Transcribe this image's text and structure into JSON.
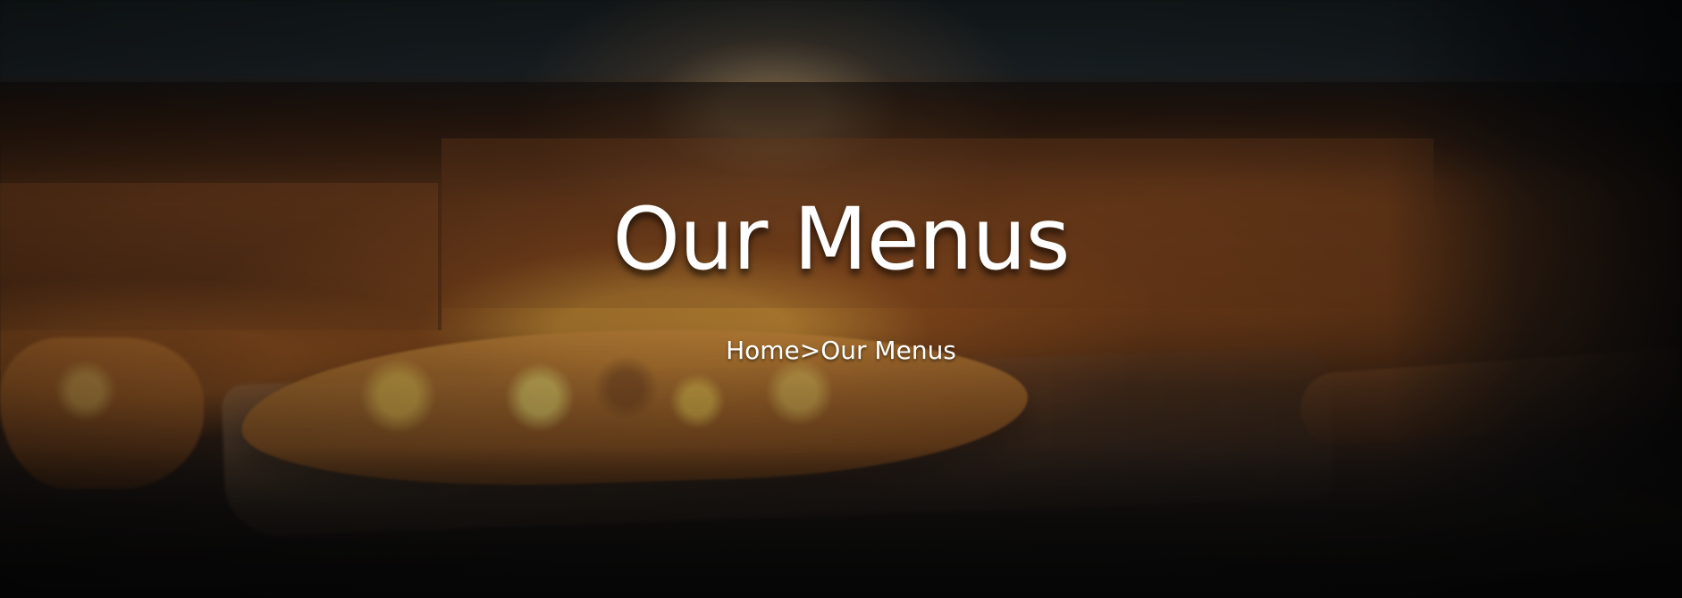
{
  "hero": {
    "title": "Our Menus",
    "breadcrumb": {
      "home": "Home",
      "separator": ">",
      "current": "Our Menus"
    }
  },
  "colors": {
    "text": "#FFFFFF",
    "overlay": "#000000",
    "warm_light": "#D98A35",
    "oven_wall": "#6B3B1C"
  }
}
